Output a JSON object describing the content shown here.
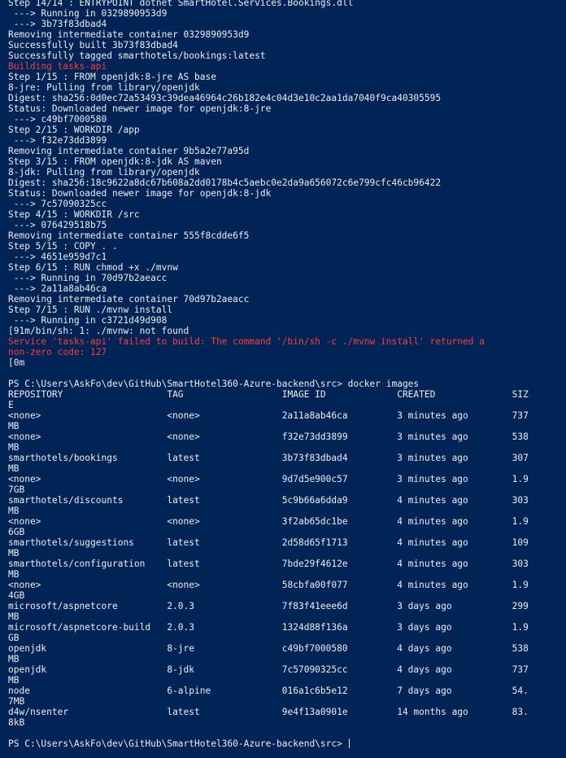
{
  "terminal": {
    "background": "#012456",
    "text_color": "#eeedf0",
    "error_color": "#ff3b3b",
    "lines": [
      {
        "text": "Step 14/14 : ENTRYPOINT dotnet SmartHotel.Services.Bookings.dll",
        "type": "normal"
      },
      {
        "text": " ---> Running in 0329890953d9",
        "type": "normal"
      },
      {
        "text": " ---> 3b73f83dbad4",
        "type": "normal"
      },
      {
        "text": "Removing intermediate container 0329890953d9",
        "type": "normal"
      },
      {
        "text": "Successfully built 3b73f83dbad4",
        "type": "normal"
      },
      {
        "text": "Successfully tagged smarthotels/bookings:latest",
        "type": "normal"
      },
      {
        "text": "Building tasks-api",
        "type": "error"
      },
      {
        "text": "Step 1/15 : FROM openjdk:8-jre AS base",
        "type": "normal"
      },
      {
        "text": "8-jre: Pulling from library/openjdk",
        "type": "normal"
      },
      {
        "text": "Digest: sha256:0d0ec72a53493c39dea46964c26b182e4c04d3e10c2aa1da7040f9ca40305595",
        "type": "normal"
      },
      {
        "text": "Status: Downloaded newer image for openjdk:8-jre",
        "type": "normal"
      },
      {
        "text": " ---> c49bf7000580",
        "type": "normal"
      },
      {
        "text": "Step 2/15 : WORKDIR /app",
        "type": "normal"
      },
      {
        "text": " ---> f32e73dd3899",
        "type": "normal"
      },
      {
        "text": "Removing intermediate container 9b5a2e77a95d",
        "type": "normal"
      },
      {
        "text": "Step 3/15 : FROM openjdk:8-jdk AS maven",
        "type": "normal"
      },
      {
        "text": "8-jdk: Pulling from library/openjdk",
        "type": "normal"
      },
      {
        "text": "Digest: sha256:18c9622a8dc67b608a2dd0178b4c5aebc0e2da9a656072c6e799cfc46cb96422",
        "type": "normal"
      },
      {
        "text": "Status: Downloaded newer image for openjdk:8-jdk",
        "type": "normal"
      },
      {
        "text": " ---> 7c57090325cc",
        "type": "normal"
      },
      {
        "text": "Step 4/15 : WORKDIR /src",
        "type": "normal"
      },
      {
        "text": " ---> 076429518b75",
        "type": "normal"
      },
      {
        "text": "Removing intermediate container 555f8cdde6f5",
        "type": "normal"
      },
      {
        "text": "Step 5/15 : COPY . .",
        "type": "normal"
      },
      {
        "text": " ---> 4651e959d7c1",
        "type": "normal"
      },
      {
        "text": "Step 6/15 : RUN chmod +x ./mvnw",
        "type": "normal"
      },
      {
        "text": " ---> Running in 70d97b2aeacc",
        "type": "normal"
      },
      {
        "text": " ---> 2a11a8ab46ca",
        "type": "normal"
      },
      {
        "text": "Removing intermediate container 70d97b2aeacc",
        "type": "normal"
      },
      {
        "text": "Step 7/15 : RUN ./mvnw install",
        "type": "normal"
      },
      {
        "text": " ---> Running in c3721d49d908",
        "type": "normal"
      },
      {
        "text": "[91m/bin/sh: 1: ./mvnw: not found",
        "type": "normal"
      },
      {
        "text": "Service 'tasks-api' failed to build: The command '/bin/sh -c ./mvnw install' returned a",
        "type": "error"
      },
      {
        "text": "non-zero code: 127",
        "type": "error"
      },
      {
        "text": "[0m",
        "type": "normal"
      },
      {
        "text": "",
        "type": "blank"
      },
      {
        "text": "PS C:\\Users\\AskFo\\dev\\GitHub\\SmartHotel360-Azure-backend\\src> docker images",
        "type": "normal"
      },
      {
        "text": "REPOSITORY                   TAG                  IMAGE ID             CREATED              SIZ",
        "type": "normal"
      },
      {
        "text": "E",
        "type": "normal"
      },
      {
        "text": "<none>                       <none>               2a11a8ab46ca         3 minutes ago        737",
        "type": "normal"
      },
      {
        "text": "MB",
        "type": "normal"
      },
      {
        "text": "<none>                       <none>               f32e73dd3899         3 minutes ago        538",
        "type": "normal"
      },
      {
        "text": "MB",
        "type": "normal"
      },
      {
        "text": "smarthotels/bookings         latest               3b73f83dbad4         3 minutes ago        307",
        "type": "normal"
      },
      {
        "text": "MB",
        "type": "normal"
      },
      {
        "text": "<none>                       <none>               9d7d5e900c57         3 minutes ago        1.9",
        "type": "normal"
      },
      {
        "text": "7GB",
        "type": "normal"
      },
      {
        "text": "smarthotels/discounts        latest               5c9b66a6dda9         4 minutes ago        303",
        "type": "normal"
      },
      {
        "text": "MB",
        "type": "normal"
      },
      {
        "text": "<none>                       <none>               3f2ab65dc1be         4 minutes ago        1.9",
        "type": "normal"
      },
      {
        "text": "6GB",
        "type": "normal"
      },
      {
        "text": "smarthotels/suggestions      latest               2d58d65f1713         4 minutes ago        109",
        "type": "normal"
      },
      {
        "text": "MB",
        "type": "normal"
      },
      {
        "text": "smarthotels/configuration    latest               7bde29f4612e         4 minutes ago        303",
        "type": "normal"
      },
      {
        "text": "MB",
        "type": "normal"
      },
      {
        "text": "<none>                       <none>               58cbfa00f077         4 minutes ago        1.9",
        "type": "normal"
      },
      {
        "text": "4GB",
        "type": "normal"
      },
      {
        "text": "microsoft/aspnetcore         2.0.3                7f83f41eee6d         3 days ago           299",
        "type": "normal"
      },
      {
        "text": "MB",
        "type": "normal"
      },
      {
        "text": "microsoft/aspnetcore-build   2.0.3                1324d88f136a         3 days ago           1.9",
        "type": "normal"
      },
      {
        "text": "GB",
        "type": "normal"
      },
      {
        "text": "openjdk                      8-jre                c49bf7000580         4 days ago           538",
        "type": "normal"
      },
      {
        "text": "MB",
        "type": "normal"
      },
      {
        "text": "openjdk                      8-jdk                7c57090325cc         4 days ago           737",
        "type": "normal"
      },
      {
        "text": "MB",
        "type": "normal"
      },
      {
        "text": "node                         6-alpine             016a1c6b5e12         7 days ago           54.",
        "type": "normal"
      },
      {
        "text": "7MB",
        "type": "normal"
      },
      {
        "text": "d4w/nsenter                  latest               9e4f13a0901e         14 months ago        83.",
        "type": "normal"
      },
      {
        "text": "8kB",
        "type": "normal"
      },
      {
        "text": "",
        "type": "blank"
      },
      {
        "text": "PS C:\\Users\\AskFo\\dev\\GitHub\\SmartHotel360-Azure-backend\\src> ",
        "type": "prompt"
      }
    ]
  }
}
